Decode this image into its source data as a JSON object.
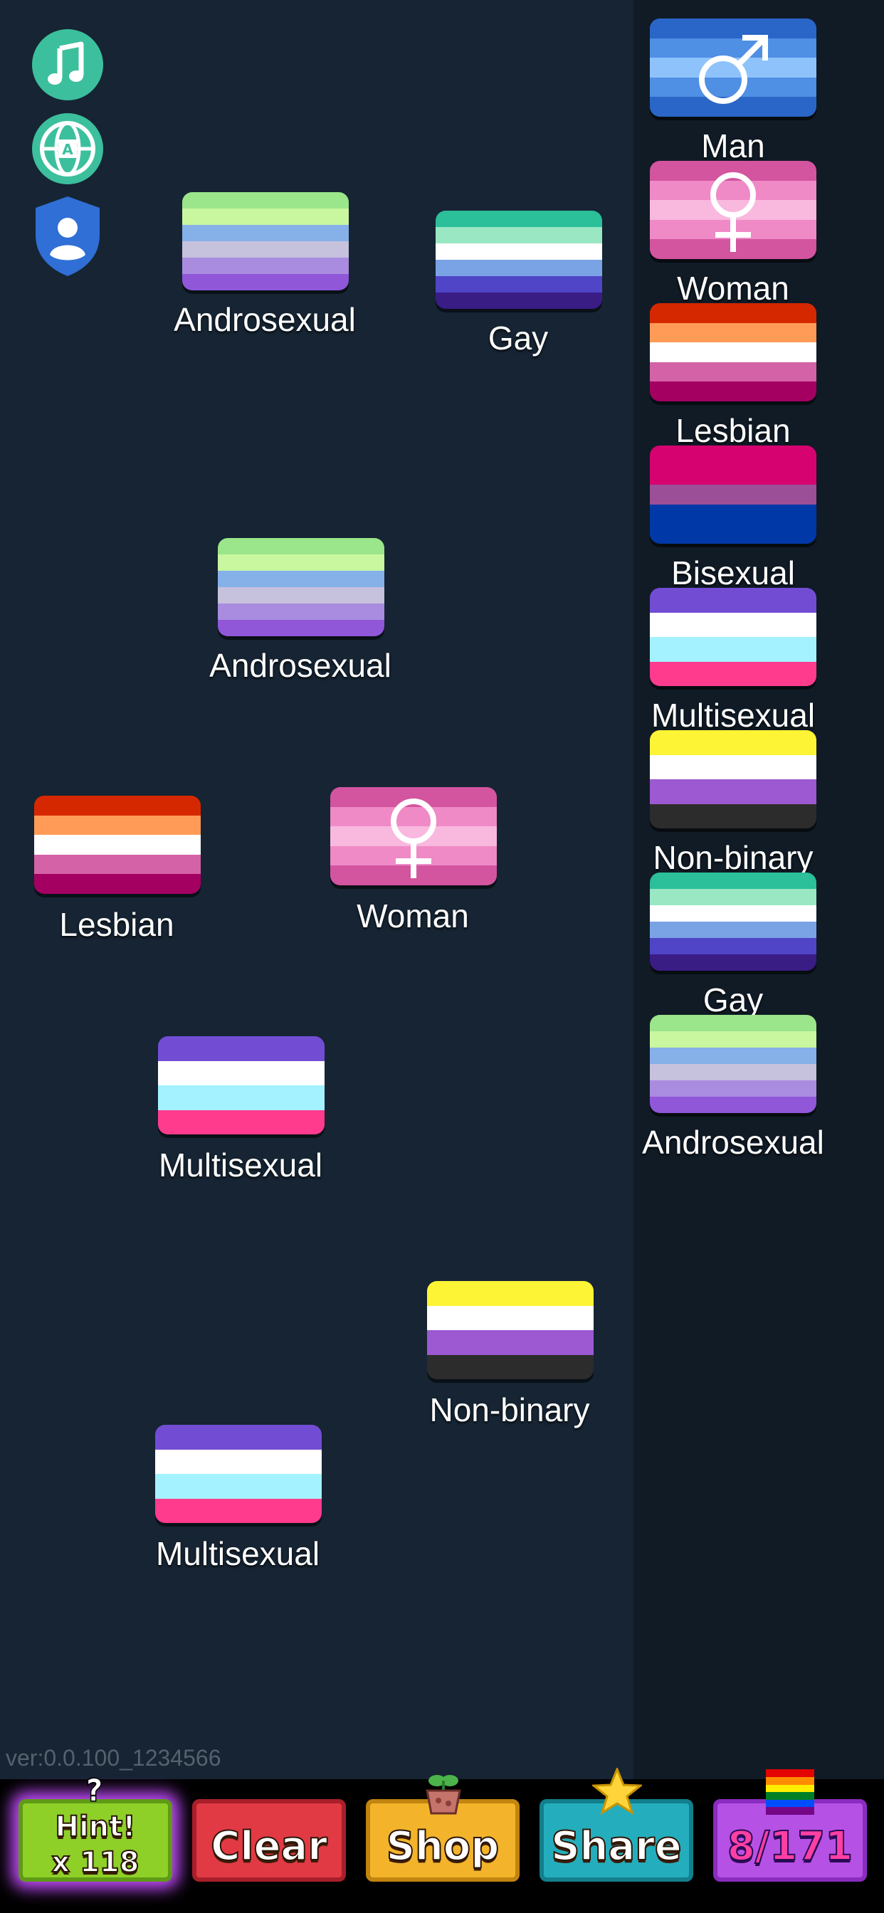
{
  "colors": {
    "background": "#162433",
    "sidebar": "#101b26",
    "icon_teal": "#3cbf9d",
    "shield_blue": "#2f6fd6"
  },
  "top_left_icons": [
    {
      "name": "music-icon"
    },
    {
      "name": "language-globe-icon"
    },
    {
      "name": "privacy-shield-icon"
    }
  ],
  "flag_palettes": {
    "Androsexual": [
      "#9be58b",
      "#c9f79f",
      "#86b0e8",
      "#c6c1dc",
      "#a98ce0",
      "#9057d9"
    ],
    "Gay": [
      "#2bbf9a",
      "#99e7c3",
      "#ffffff",
      "#7aa3e6",
      "#4f45c6",
      "#3a1c85"
    ],
    "Lesbian": [
      "#d62800",
      "#ff9b56",
      "#ffffff",
      "#d462a6",
      "#a40062"
    ],
    "Bisexual": [
      "#d60270",
      "#d60270",
      "#9b4f96",
      "#0038a8",
      "#0038a8"
    ],
    "Multisexual": [
      "#724dd4",
      "#ffffff",
      "#a4f2ff",
      "#ff3b8e"
    ],
    "Non-binary": [
      "#fcf434",
      "#ffffff",
      "#9c59d1",
      "#2c2c2c"
    ],
    "Man": [
      "#2a66c8",
      "#4f8fe4",
      "#8ec2fb",
      "#4f8fe4",
      "#2a66c8"
    ],
    "Woman": [
      "#d3549f",
      "#ef8ac6",
      "#f9b8de",
      "#ef8ac6",
      "#d3549f"
    ]
  },
  "board_flags": [
    {
      "label": "Androsexual",
      "type": "Androsexual"
    },
    {
      "label": "Gay",
      "type": "Gay"
    },
    {
      "label": "Androsexual",
      "type": "Androsexual"
    },
    {
      "label": "Lesbian",
      "type": "Lesbian"
    },
    {
      "label": "Woman",
      "type": "Woman",
      "symbol": "female-symbol-icon"
    },
    {
      "label": "Multisexual",
      "type": "Multisexual"
    },
    {
      "label": "Non-binary",
      "type": "Non-binary"
    },
    {
      "label": "Multisexual",
      "type": "Multisexual"
    }
  ],
  "sidebar_flags": [
    {
      "label": "Man",
      "type": "Man",
      "symbol": "male-symbol-icon"
    },
    {
      "label": "Woman",
      "type": "Woman",
      "symbol": "female-symbol-icon"
    },
    {
      "label": "Lesbian",
      "type": "Lesbian"
    },
    {
      "label": "Bisexual",
      "type": "Bisexual"
    },
    {
      "label": "Multisexual",
      "type": "Multisexual"
    },
    {
      "label": "Non-binary",
      "type": "Non-binary"
    },
    {
      "label": "Gay",
      "type": "Gay"
    },
    {
      "label": "Androsexual",
      "type": "Androsexual"
    }
  ],
  "version": "ver:0.0.100_1234566",
  "buttons": {
    "hint_label": "Hint!",
    "hint_count": "x 118",
    "clear": "Clear",
    "shop": "Shop",
    "share": "Share",
    "progress": "8/171"
  }
}
